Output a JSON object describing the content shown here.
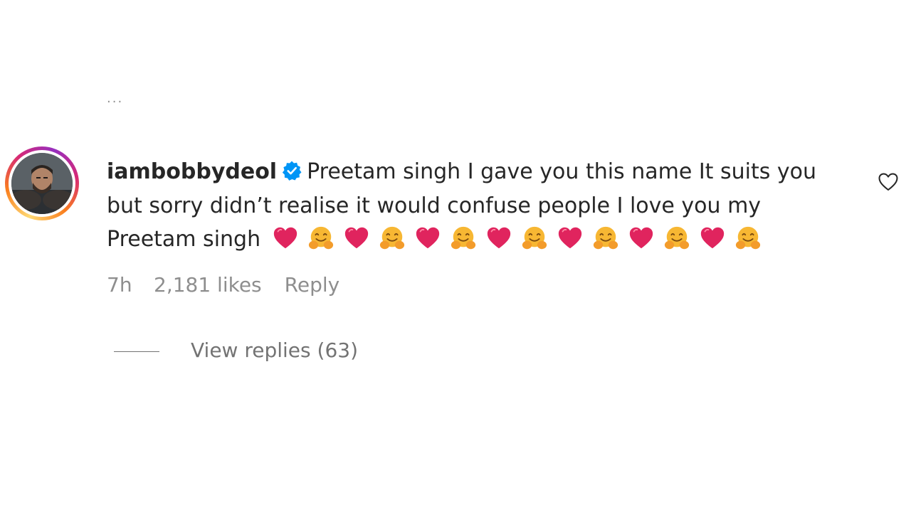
{
  "top_ellipsis": "...",
  "comment": {
    "username": "iambobbydeol",
    "verified": true,
    "text": "Preetam singh I gave you this name It suits you but sorry didn’t realise it would confuse people I love you my Preetam singh",
    "emoji_sequence": [
      "red-heart",
      "hugging-face",
      "red-heart",
      "hugging-face",
      "red-heart",
      "hugging-face",
      "red-heart",
      "hugging-face",
      "red-heart",
      "hugging-face",
      "red-heart",
      "hugging-face",
      "red-heart",
      "hugging-face"
    ],
    "time": "7h",
    "likes": "2,181 likes",
    "reply_label": "Reply",
    "view_replies_label": "View replies (63)"
  },
  "colors": {
    "text": "#262626",
    "muted": "#8e8e8e",
    "verified_blue": "#0095f6",
    "heart_red": "#e0245e",
    "hug_orange": "#f7a630"
  },
  "icons": {
    "verified": "verified-badge-icon",
    "like": "heart-outline-icon"
  }
}
